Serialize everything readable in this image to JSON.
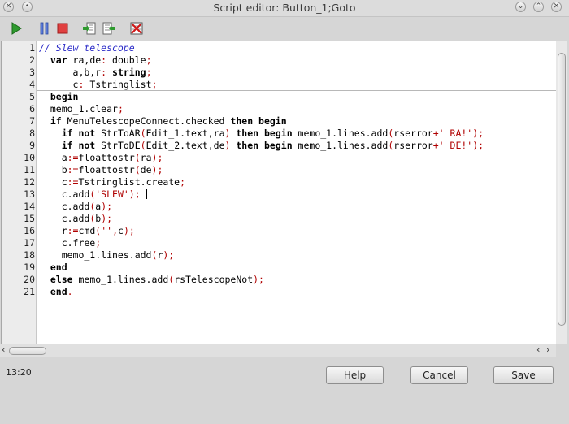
{
  "window": {
    "title": "Script editor: Button_1;Goto"
  },
  "title_buttons": [
    {
      "name": "window-menu-icon",
      "glyph": "✕"
    },
    {
      "name": "window-shade-icon",
      "glyph": "•"
    },
    {
      "name": "minimize-icon",
      "glyph": "⌄"
    },
    {
      "name": "maximize-icon",
      "glyph": "⌃"
    },
    {
      "name": "close-icon",
      "glyph": "✕"
    }
  ],
  "toolbar": {
    "icons": [
      "run-icon",
      "pause-icon",
      "stop-icon",
      "step-into-icon",
      "step-over-icon",
      "toggle-breakpoint-icon"
    ]
  },
  "editor": {
    "line_numbers": [
      "1",
      "2",
      "3",
      "4",
      "5",
      "6",
      "7",
      "8",
      "9",
      "10",
      "11",
      "12",
      "13",
      "14",
      "15",
      "16",
      "17",
      "18",
      "19",
      "20",
      "21"
    ],
    "lines": [
      [
        [
          "cmt",
          "// Slew telescope"
        ]
      ],
      [
        [
          "kw",
          "  var "
        ],
        [
          "txt",
          "ra,de"
        ],
        [
          "sym",
          ":"
        ],
        [
          "txt",
          " double"
        ],
        [
          "sym",
          ";"
        ]
      ],
      [
        [
          "txt",
          "      a,b,r"
        ],
        [
          "sym",
          ":"
        ],
        [
          "kw",
          " string"
        ],
        [
          "sym",
          ";"
        ]
      ],
      [
        [
          "txt",
          "      c"
        ],
        [
          "sym",
          ":"
        ],
        [
          "txt",
          " Tstringlist"
        ],
        [
          "sym",
          ";"
        ]
      ],
      [
        [
          "kw",
          "  begin"
        ]
      ],
      [
        [
          "txt",
          "  memo_1.clear"
        ],
        [
          "sym",
          ";"
        ]
      ],
      [
        [
          "kw",
          "  if "
        ],
        [
          "txt",
          "MenuTelescopeConnect.checked "
        ],
        [
          "kw",
          "then begin"
        ]
      ],
      [
        [
          "kw",
          "    if not "
        ],
        [
          "txt",
          "StrToAR"
        ],
        [
          "sym",
          "("
        ],
        [
          "txt",
          "Edit_1.text,ra"
        ],
        [
          "sym",
          ")"
        ],
        [
          "kw",
          " then begin "
        ],
        [
          "txt",
          "memo_1.lines.add"
        ],
        [
          "sym",
          "("
        ],
        [
          "txt",
          "rserror"
        ],
        [
          "sym",
          "+"
        ],
        [
          "str",
          "' RA!'"
        ],
        [
          "sym",
          ");"
        ]
      ],
      [
        [
          "kw",
          "    if not "
        ],
        [
          "txt",
          "StrToDE"
        ],
        [
          "sym",
          "("
        ],
        [
          "txt",
          "Edit_2.text,de"
        ],
        [
          "sym",
          ")"
        ],
        [
          "kw",
          " then begin "
        ],
        [
          "txt",
          "memo_1.lines.add"
        ],
        [
          "sym",
          "("
        ],
        [
          "txt",
          "rserror"
        ],
        [
          "sym",
          "+"
        ],
        [
          "str",
          "' DE!'"
        ],
        [
          "sym",
          ");"
        ]
      ],
      [
        [
          "txt",
          "    a"
        ],
        [
          "sym",
          ":="
        ],
        [
          "txt",
          "floattostr"
        ],
        [
          "sym",
          "("
        ],
        [
          "txt",
          "ra"
        ],
        [
          "sym",
          ");"
        ]
      ],
      [
        [
          "txt",
          "    b"
        ],
        [
          "sym",
          ":="
        ],
        [
          "txt",
          "floattostr"
        ],
        [
          "sym",
          "("
        ],
        [
          "txt",
          "de"
        ],
        [
          "sym",
          ");"
        ]
      ],
      [
        [
          "txt",
          "    c"
        ],
        [
          "sym",
          ":="
        ],
        [
          "txt",
          "Tstringlist.create"
        ],
        [
          "sym",
          ";"
        ]
      ],
      [
        [
          "txt",
          "    c.add"
        ],
        [
          "sym",
          "("
        ],
        [
          "str",
          "'SLEW'"
        ],
        [
          "sym",
          ");"
        ],
        [
          "txt",
          " "
        ]
      ],
      [
        [
          "txt",
          "    c.add"
        ],
        [
          "sym",
          "("
        ],
        [
          "txt",
          "a"
        ],
        [
          "sym",
          ");"
        ]
      ],
      [
        [
          "txt",
          "    c.add"
        ],
        [
          "sym",
          "("
        ],
        [
          "txt",
          "b"
        ],
        [
          "sym",
          ");"
        ]
      ],
      [
        [
          "txt",
          "    r"
        ],
        [
          "sym",
          ":="
        ],
        [
          "txt",
          "cmd"
        ],
        [
          "sym",
          "("
        ],
        [
          "str",
          "''"
        ],
        [
          "sym",
          ","
        ],
        [
          "txt",
          "c"
        ],
        [
          "sym",
          ");"
        ]
      ],
      [
        [
          "txt",
          "    c.free"
        ],
        [
          "sym",
          ";"
        ]
      ],
      [
        [
          "txt",
          "    memo_1.lines.add"
        ],
        [
          "sym",
          "("
        ],
        [
          "txt",
          "r"
        ],
        [
          "sym",
          ");"
        ]
      ],
      [
        [
          "kw",
          "  end"
        ]
      ],
      [
        [
          "kw",
          "  else "
        ],
        [
          "txt",
          "memo_1.lines.add"
        ],
        [
          "sym",
          "("
        ],
        [
          "txt",
          "rsTelescopeNot"
        ],
        [
          "sym",
          ");"
        ]
      ],
      [
        [
          "kw",
          "  end"
        ],
        [
          "sym",
          "."
        ]
      ]
    ]
  },
  "statusbar": {
    "position": "13:20"
  },
  "buttons": {
    "help": "Help",
    "cancel": "Cancel",
    "save": "Save"
  }
}
